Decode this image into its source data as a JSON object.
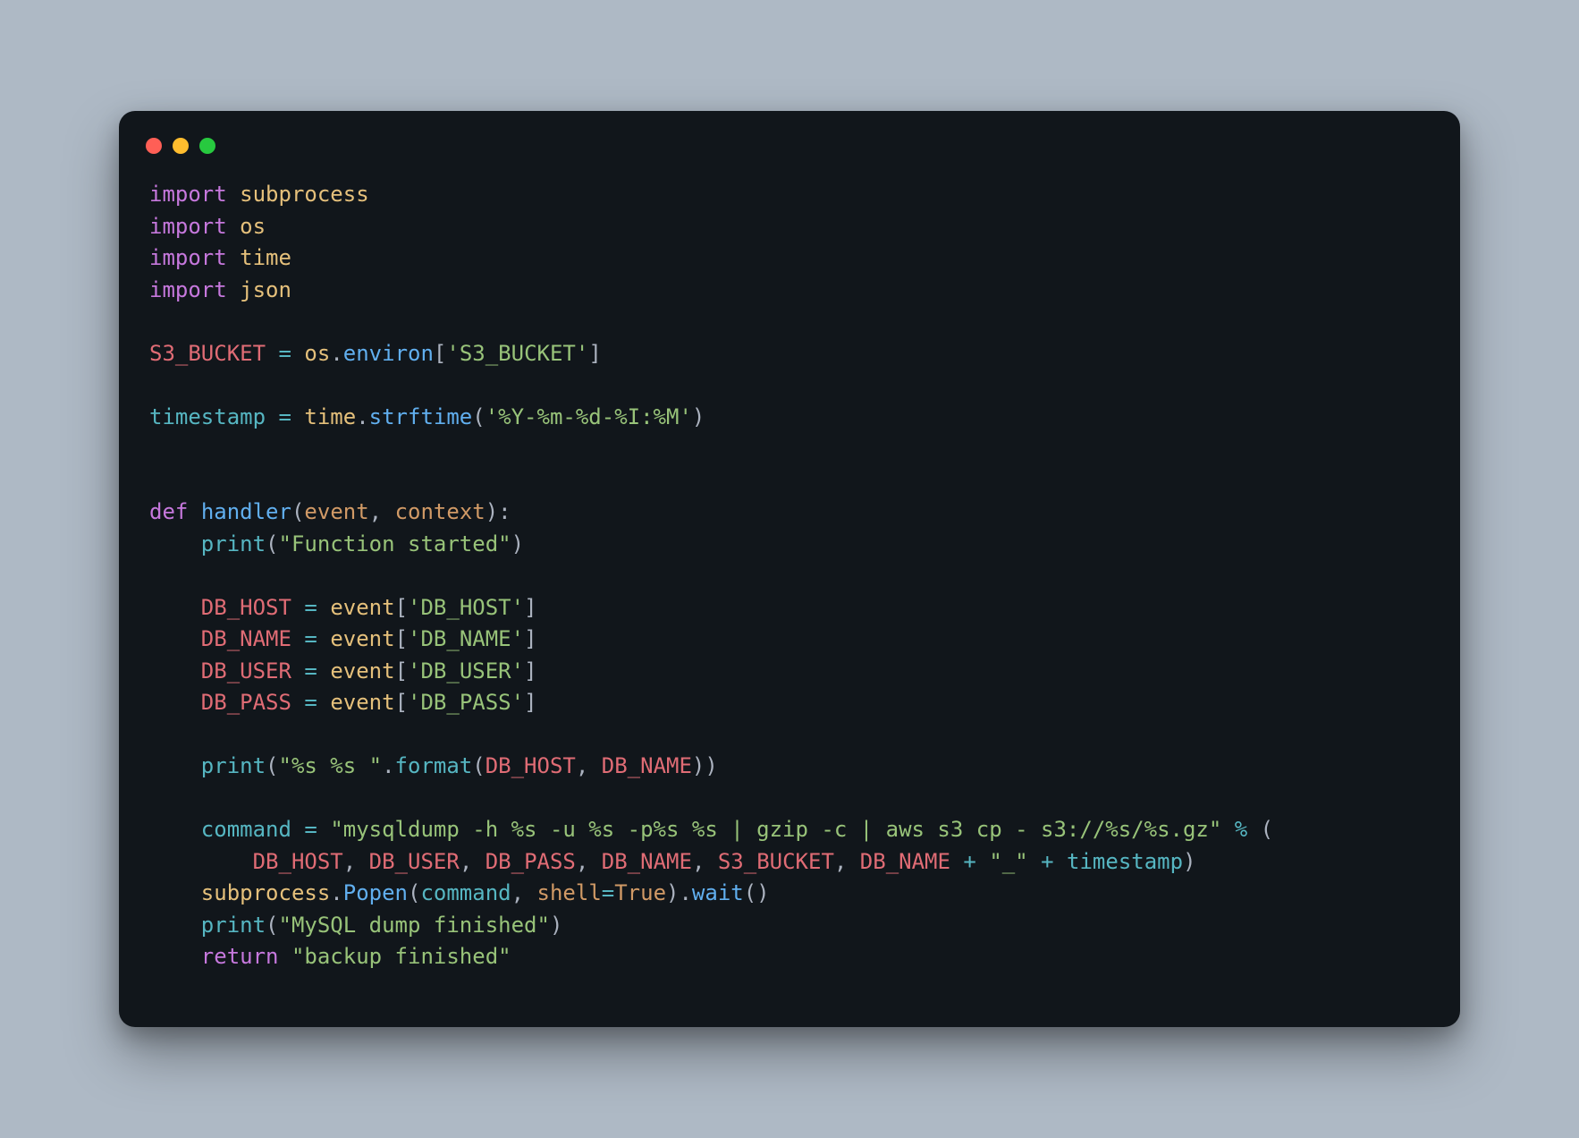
{
  "colors": {
    "page_bg": "#aeb9c5",
    "window_bg": "#11161b",
    "traffic_red": "#ff5f56",
    "traffic_yellow": "#ffbd2e",
    "traffic_green": "#27c93f"
  },
  "code": {
    "lines": [
      [
        {
          "t": "import",
          "c": "kw"
        },
        {
          "t": " ",
          "c": "name"
        },
        {
          "t": "subprocess",
          "c": "mod"
        }
      ],
      [
        {
          "t": "import",
          "c": "kw"
        },
        {
          "t": " ",
          "c": "name"
        },
        {
          "t": "os",
          "c": "mod"
        }
      ],
      [
        {
          "t": "import",
          "c": "kw"
        },
        {
          "t": " ",
          "c": "name"
        },
        {
          "t": "time",
          "c": "mod"
        }
      ],
      [
        {
          "t": "import",
          "c": "kw"
        },
        {
          "t": " ",
          "c": "name"
        },
        {
          "t": "json",
          "c": "mod"
        }
      ],
      [],
      [
        {
          "t": "S3_BUCKET",
          "c": "const"
        },
        {
          "t": " ",
          "c": "name"
        },
        {
          "t": "=",
          "c": "op"
        },
        {
          "t": " ",
          "c": "name"
        },
        {
          "t": "os",
          "c": "mod"
        },
        {
          "t": ".",
          "c": "punct"
        },
        {
          "t": "environ",
          "c": "func"
        },
        {
          "t": "[",
          "c": "punct"
        },
        {
          "t": "'S3_BUCKET'",
          "c": "str"
        },
        {
          "t": "]",
          "c": "punct"
        }
      ],
      [],
      [
        {
          "t": "timestamp",
          "c": "var"
        },
        {
          "t": " ",
          "c": "name"
        },
        {
          "t": "=",
          "c": "op"
        },
        {
          "t": " ",
          "c": "name"
        },
        {
          "t": "time",
          "c": "mod"
        },
        {
          "t": ".",
          "c": "punct"
        },
        {
          "t": "strftime",
          "c": "func"
        },
        {
          "t": "(",
          "c": "punct"
        },
        {
          "t": "'%Y-%m-%d-%I:%M'",
          "c": "str"
        },
        {
          "t": ")",
          "c": "punct"
        }
      ],
      [],
      [],
      [
        {
          "t": "def",
          "c": "kw"
        },
        {
          "t": " ",
          "c": "name"
        },
        {
          "t": "handler",
          "c": "func"
        },
        {
          "t": "(",
          "c": "punct"
        },
        {
          "t": "event",
          "c": "param"
        },
        {
          "t": ",",
          "c": "punct"
        },
        {
          "t": " ",
          "c": "name"
        },
        {
          "t": "context",
          "c": "param"
        },
        {
          "t": "):",
          "c": "punct"
        }
      ],
      [
        {
          "t": "    ",
          "c": "name"
        },
        {
          "t": "print",
          "c": "call"
        },
        {
          "t": "(",
          "c": "punct"
        },
        {
          "t": "\"Function started\"",
          "c": "str"
        },
        {
          "t": ")",
          "c": "punct"
        }
      ],
      [],
      [
        {
          "t": "    ",
          "c": "name"
        },
        {
          "t": "DB_HOST",
          "c": "const"
        },
        {
          "t": " ",
          "c": "name"
        },
        {
          "t": "=",
          "c": "op"
        },
        {
          "t": " ",
          "c": "name"
        },
        {
          "t": "event",
          "c": "mod"
        },
        {
          "t": "[",
          "c": "punct"
        },
        {
          "t": "'DB_HOST'",
          "c": "str"
        },
        {
          "t": "]",
          "c": "punct"
        }
      ],
      [
        {
          "t": "    ",
          "c": "name"
        },
        {
          "t": "DB_NAME",
          "c": "const"
        },
        {
          "t": " ",
          "c": "name"
        },
        {
          "t": "=",
          "c": "op"
        },
        {
          "t": " ",
          "c": "name"
        },
        {
          "t": "event",
          "c": "mod"
        },
        {
          "t": "[",
          "c": "punct"
        },
        {
          "t": "'DB_NAME'",
          "c": "str"
        },
        {
          "t": "]",
          "c": "punct"
        }
      ],
      [
        {
          "t": "    ",
          "c": "name"
        },
        {
          "t": "DB_USER",
          "c": "const"
        },
        {
          "t": " ",
          "c": "name"
        },
        {
          "t": "=",
          "c": "op"
        },
        {
          "t": " ",
          "c": "name"
        },
        {
          "t": "event",
          "c": "mod"
        },
        {
          "t": "[",
          "c": "punct"
        },
        {
          "t": "'DB_USER'",
          "c": "str"
        },
        {
          "t": "]",
          "c": "punct"
        }
      ],
      [
        {
          "t": "    ",
          "c": "name"
        },
        {
          "t": "DB_PASS",
          "c": "const"
        },
        {
          "t": " ",
          "c": "name"
        },
        {
          "t": "=",
          "c": "op"
        },
        {
          "t": " ",
          "c": "name"
        },
        {
          "t": "event",
          "c": "mod"
        },
        {
          "t": "[",
          "c": "punct"
        },
        {
          "t": "'DB_PASS'",
          "c": "str"
        },
        {
          "t": "]",
          "c": "punct"
        }
      ],
      [],
      [
        {
          "t": "    ",
          "c": "name"
        },
        {
          "t": "print",
          "c": "call"
        },
        {
          "t": "(",
          "c": "punct"
        },
        {
          "t": "\"%s %s \"",
          "c": "str"
        },
        {
          "t": ".",
          "c": "punct"
        },
        {
          "t": "format",
          "c": "call"
        },
        {
          "t": "(",
          "c": "punct"
        },
        {
          "t": "DB_HOST",
          "c": "const"
        },
        {
          "t": ",",
          "c": "punct"
        },
        {
          "t": " ",
          "c": "name"
        },
        {
          "t": "DB_NAME",
          "c": "const"
        },
        {
          "t": "))",
          "c": "punct"
        }
      ],
      [],
      [
        {
          "t": "    ",
          "c": "name"
        },
        {
          "t": "command",
          "c": "var"
        },
        {
          "t": " ",
          "c": "name"
        },
        {
          "t": "=",
          "c": "op"
        },
        {
          "t": " ",
          "c": "name"
        },
        {
          "t": "\"mysqldump -h %s -u %s -p%s %s | gzip -c | aws s3 cp - s3://%s/%s.gz\"",
          "c": "str"
        },
        {
          "t": " ",
          "c": "name"
        },
        {
          "t": "%",
          "c": "op"
        },
        {
          "t": " (",
          "c": "punct"
        }
      ],
      [
        {
          "t": "        ",
          "c": "name"
        },
        {
          "t": "DB_HOST",
          "c": "const"
        },
        {
          "t": ",",
          "c": "punct"
        },
        {
          "t": " ",
          "c": "name"
        },
        {
          "t": "DB_USER",
          "c": "const"
        },
        {
          "t": ",",
          "c": "punct"
        },
        {
          "t": " ",
          "c": "name"
        },
        {
          "t": "DB_PASS",
          "c": "const"
        },
        {
          "t": ",",
          "c": "punct"
        },
        {
          "t": " ",
          "c": "name"
        },
        {
          "t": "DB_NAME",
          "c": "const"
        },
        {
          "t": ",",
          "c": "punct"
        },
        {
          "t": " ",
          "c": "name"
        },
        {
          "t": "S3_BUCKET",
          "c": "const"
        },
        {
          "t": ",",
          "c": "punct"
        },
        {
          "t": " ",
          "c": "name"
        },
        {
          "t": "DB_NAME",
          "c": "const"
        },
        {
          "t": " ",
          "c": "name"
        },
        {
          "t": "+",
          "c": "op"
        },
        {
          "t": " ",
          "c": "name"
        },
        {
          "t": "\"_\"",
          "c": "str"
        },
        {
          "t": " ",
          "c": "name"
        },
        {
          "t": "+",
          "c": "op"
        },
        {
          "t": " ",
          "c": "name"
        },
        {
          "t": "timestamp",
          "c": "var"
        },
        {
          "t": ")",
          "c": "punct"
        }
      ],
      [
        {
          "t": "    ",
          "c": "name"
        },
        {
          "t": "subprocess",
          "c": "mod"
        },
        {
          "t": ".",
          "c": "punct"
        },
        {
          "t": "Popen",
          "c": "func"
        },
        {
          "t": "(",
          "c": "punct"
        },
        {
          "t": "command",
          "c": "var"
        },
        {
          "t": ",",
          "c": "punct"
        },
        {
          "t": " ",
          "c": "name"
        },
        {
          "t": "shell",
          "c": "param"
        },
        {
          "t": "=",
          "c": "op"
        },
        {
          "t": "True",
          "c": "true"
        },
        {
          "t": ").",
          "c": "punct"
        },
        {
          "t": "wait",
          "c": "func"
        },
        {
          "t": "()",
          "c": "punct"
        }
      ],
      [
        {
          "t": "    ",
          "c": "name"
        },
        {
          "t": "print",
          "c": "call"
        },
        {
          "t": "(",
          "c": "punct"
        },
        {
          "t": "\"MySQL dump finished\"",
          "c": "str"
        },
        {
          "t": ")",
          "c": "punct"
        }
      ],
      [
        {
          "t": "    ",
          "c": "name"
        },
        {
          "t": "return",
          "c": "kw"
        },
        {
          "t": " ",
          "c": "name"
        },
        {
          "t": "\"backup finished\"",
          "c": "str"
        }
      ]
    ]
  }
}
